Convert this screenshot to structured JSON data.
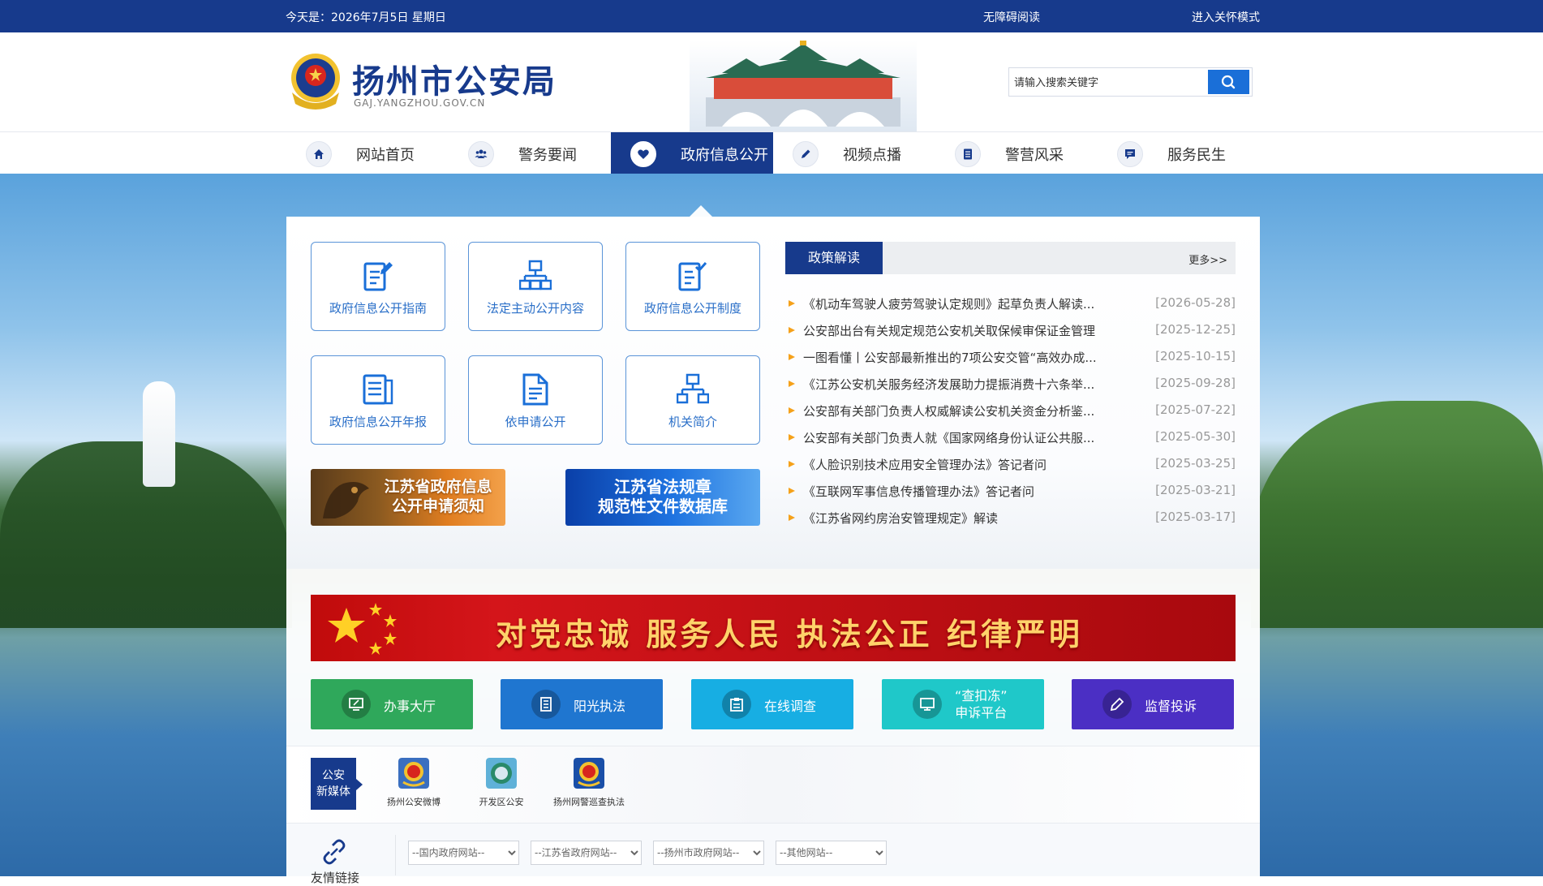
{
  "topbar": {
    "date": "今天是：2026年7月5日 星期日",
    "accessibility": "无障碍阅读",
    "care_mode": "进入关怀模式"
  },
  "header": {
    "site_name": "扬州市公安局",
    "domain": "GAJ.YANGZHOU.GOV.CN",
    "search_placeholder": "请输入搜索关键字"
  },
  "nav": [
    {
      "label": "网站首页",
      "icon": "home-icon"
    },
    {
      "label": "警务要闻",
      "icon": "people-icon"
    },
    {
      "label": "政府信息公开",
      "icon": "heart-icon",
      "active": true
    },
    {
      "label": "视频点播",
      "icon": "pencil-icon"
    },
    {
      "label": "警营风采",
      "icon": "list-icon"
    },
    {
      "label": "服务民生",
      "icon": "message-icon"
    }
  ],
  "tiles": [
    {
      "label": "政府信息公开指南",
      "icon": "doc-edit-icon"
    },
    {
      "label": "法定主动公开内容",
      "icon": "org-chart-icon"
    },
    {
      "label": "政府信息公开制度",
      "icon": "doc-check-icon"
    },
    {
      "label": "政府信息公开年报",
      "icon": "report-icon"
    },
    {
      "label": "依申请公开",
      "icon": "document-icon"
    },
    {
      "label": "机关简介",
      "icon": "org-chart-icon"
    }
  ],
  "banners": {
    "left": "江苏省政府信息公开申请须知",
    "right_line1": "江苏省法规章",
    "right_line2": "规范性文件数据库"
  },
  "policy": {
    "title": "政策解读",
    "more": "更多>>",
    "items": [
      {
        "title": "《机动车驾驶人疲劳驾驶认定规则》起草负责人解读...",
        "date": "[2026-05-28]"
      },
      {
        "title": "公安部出台有关规定规范公安机关取保候审保证金管理",
        "date": "[2025-12-25]"
      },
      {
        "title": "一图看懂丨公安部最新推出的7项公安交管“高效办成...",
        "date": "[2025-10-15]"
      },
      {
        "title": "《江苏公安机关服务经济发展助力提振消费十六条举...",
        "date": "[2025-09-28]"
      },
      {
        "title": "公安部有关部门负责人权威解读公安机关资金分析鉴...",
        "date": "[2025-07-22]"
      },
      {
        "title": "公安部有关部门负责人就《国家网络身份认证公共服...",
        "date": "[2025-05-30]"
      },
      {
        "title": "《人脸识别技术应用安全管理办法》答记者问",
        "date": "[2025-03-25]"
      },
      {
        "title": "《互联网军事信息传播管理办法》答记者问",
        "date": "[2025-03-21]"
      },
      {
        "title": "《江苏省网约房治安管理规定》解读",
        "date": "[2025-03-17]"
      }
    ]
  },
  "slogan": "对党忠诚  服务人民  执法公正  纪律严明",
  "services": [
    {
      "label": "办事大厅",
      "color": "#2fa85b",
      "icon": "monitor-icon"
    },
    {
      "label": "阳光执法",
      "color": "#1f76d0",
      "icon": "list-icon"
    },
    {
      "label": "在线调查",
      "color": "#17aee3",
      "icon": "clipboard-icon"
    },
    {
      "label_line1": "“查扣冻”",
      "label_line2": "申诉平台",
      "color": "#1fc8c9",
      "icon": "screen-icon"
    },
    {
      "label": "监督投诉",
      "color": "#4b2fc4",
      "icon": "pencil-icon"
    }
  ],
  "media": {
    "label_line1": "公安",
    "label_line2": "新媒体",
    "items": [
      {
        "name": "扬州公安微博"
      },
      {
        "name": "开发区公安"
      },
      {
        "name": "扬州网警巡查执法"
      }
    ]
  },
  "links": {
    "label": "友情链接",
    "selects": [
      "--国内政府网站--",
      "--江苏省政府网站--",
      "--扬州市政府网站--",
      "--其他网站--"
    ]
  }
}
